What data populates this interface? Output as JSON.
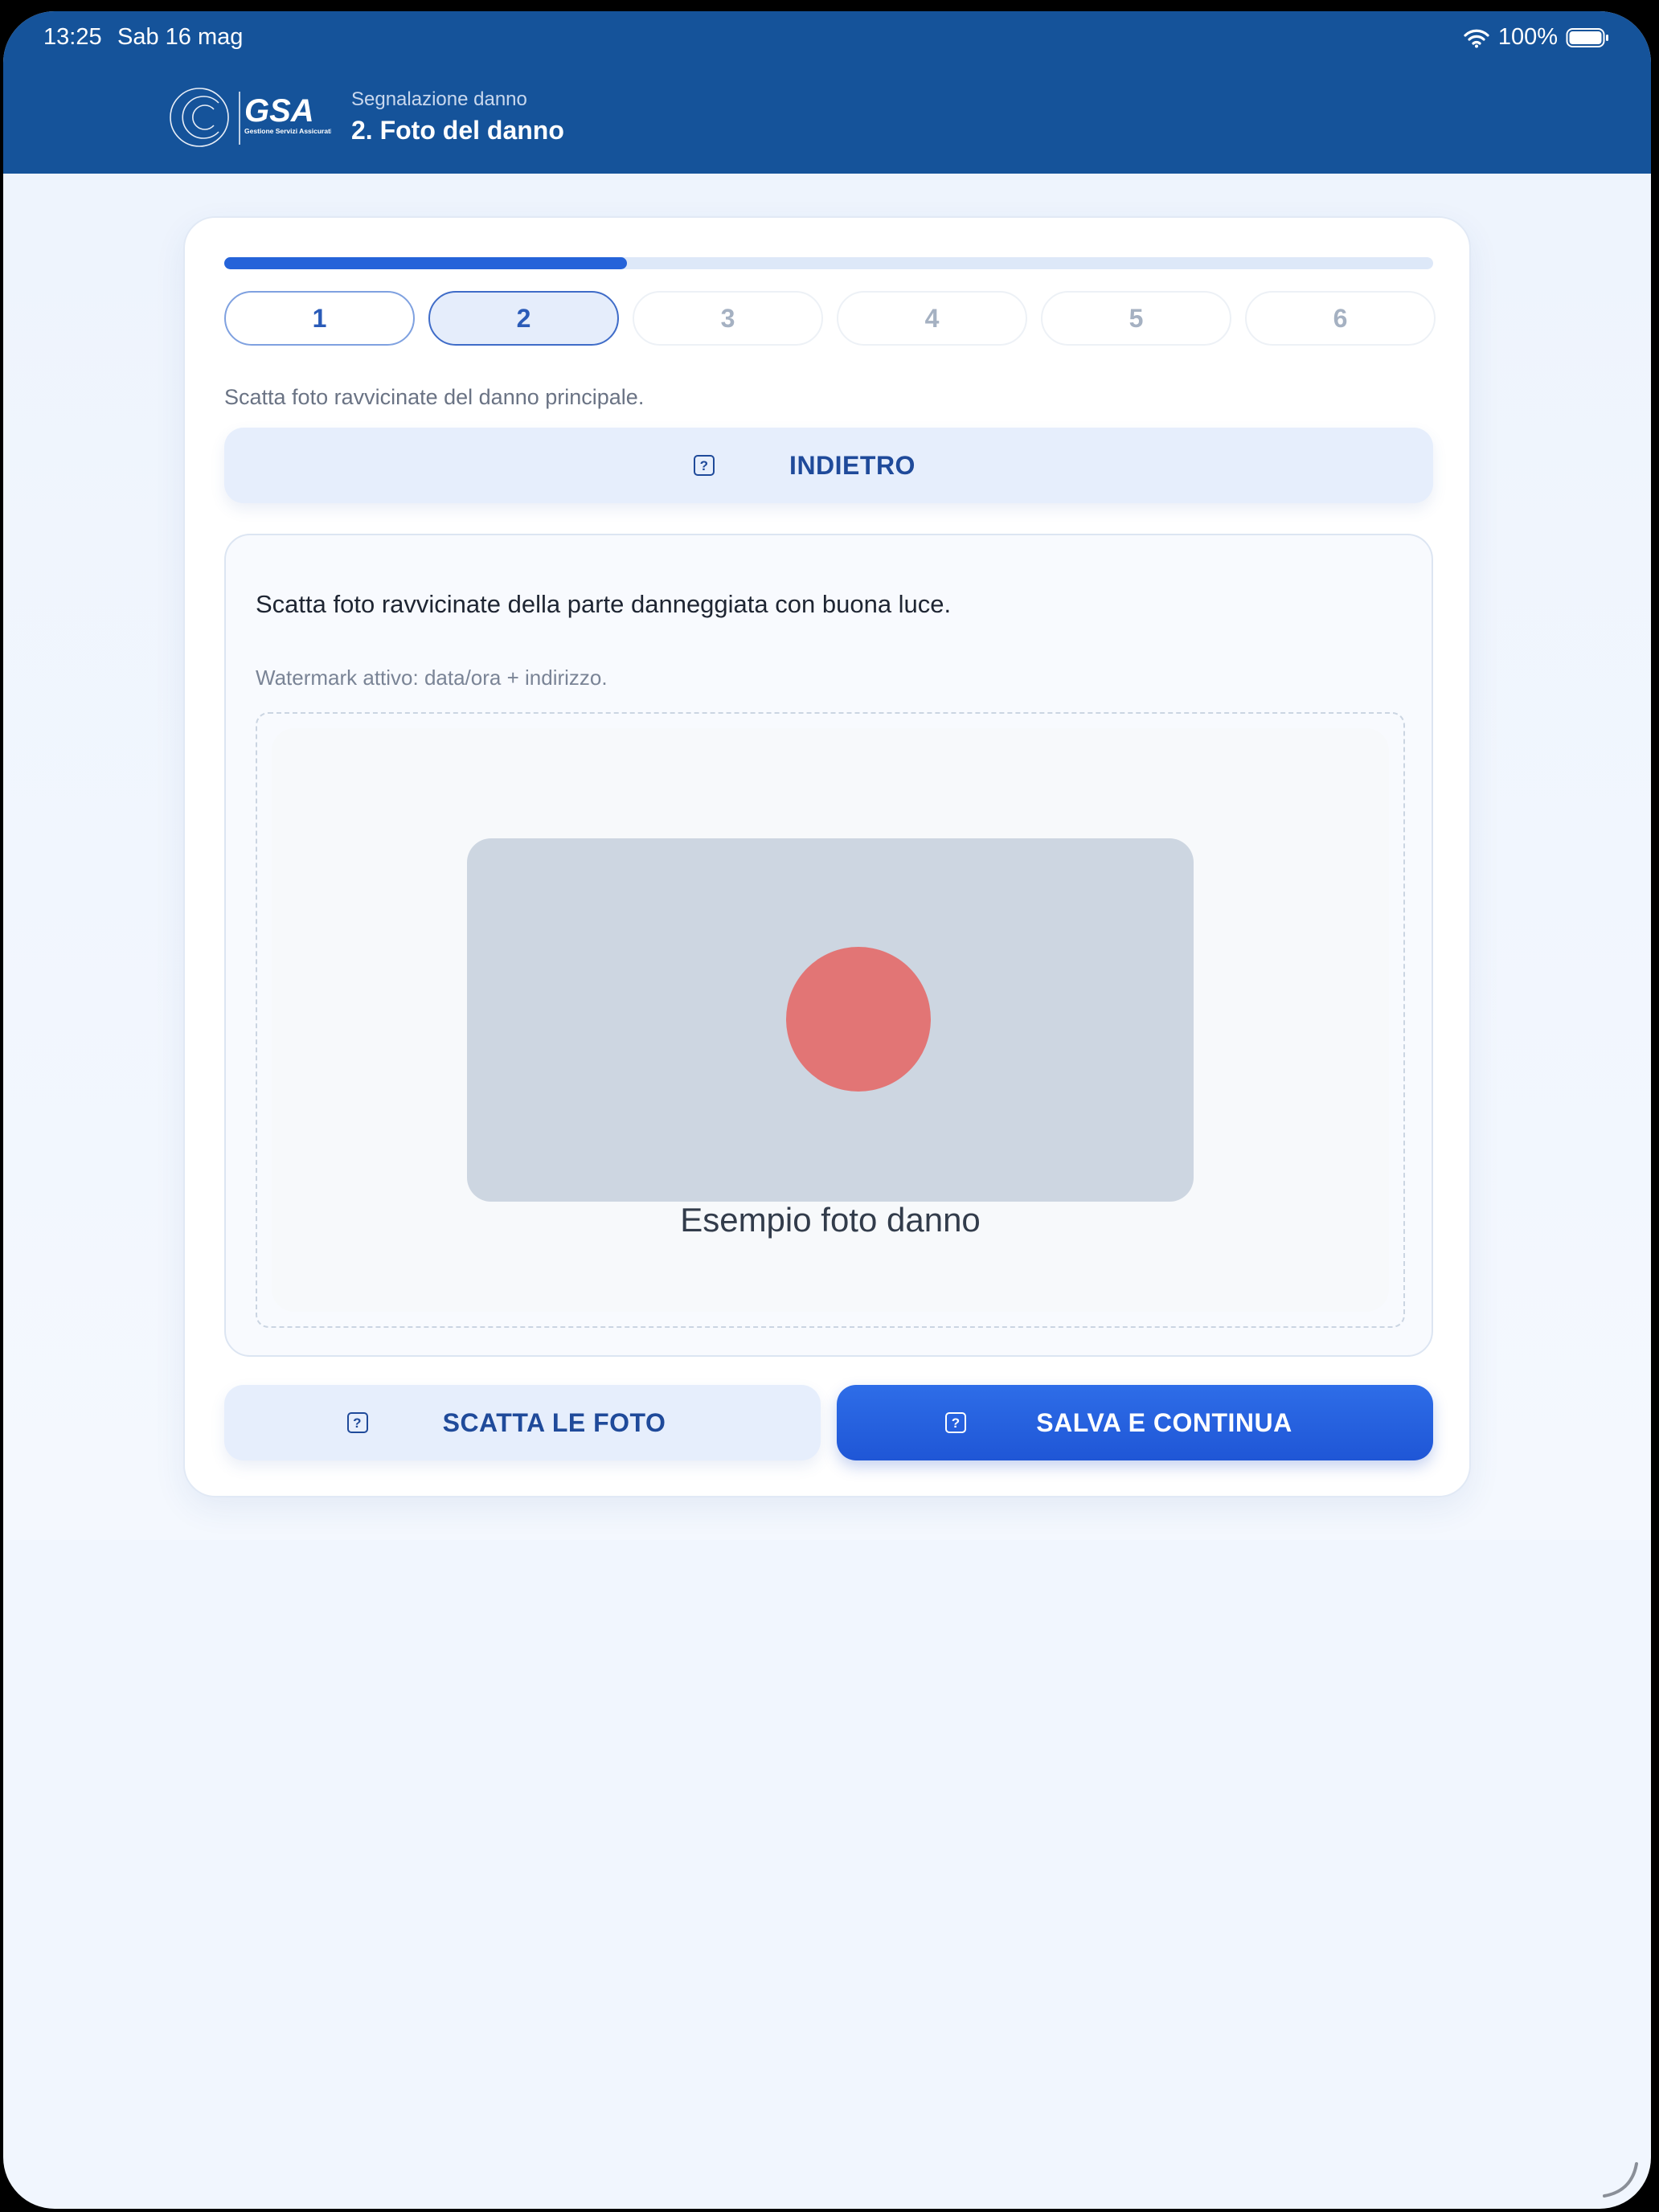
{
  "status_bar": {
    "time": "13:25",
    "date": "Sab 16 mag",
    "battery": "100%"
  },
  "header": {
    "logo_text": "GSA",
    "logo_tagline": "Gestione Servizi Assicurativi",
    "subtitle": "Segnalazione danno",
    "title": "2. Foto del danno"
  },
  "progress": {
    "value": 0.333,
    "steps": [
      {
        "label": "1",
        "state": "done"
      },
      {
        "label": "2",
        "state": "active"
      },
      {
        "label": "3",
        "state": "todo"
      },
      {
        "label": "4",
        "state": "todo"
      },
      {
        "label": "5",
        "state": "todo"
      },
      {
        "label": "6",
        "state": "todo"
      }
    ]
  },
  "hint": "Scatta foto ravvicinate del danno principale.",
  "back_button": {
    "label": "INDIETRO",
    "icon": "help-square-icon"
  },
  "panel": {
    "instruction": "Scatta foto ravvicinate della parte danneggiata con buona luce.",
    "watermark_note": "Watermark attivo: data/ora + indirizzo.",
    "sample_caption": "Esempio foto danno"
  },
  "actions": {
    "take_photos": {
      "label": "SCATTA LE FOTO",
      "icon": "help-square-icon"
    },
    "save_continue": {
      "label": "SALVA E CONTINUA",
      "icon": "help-square-icon"
    }
  },
  "colors": {
    "header_bg": "#15539a",
    "accent": "#2563d9",
    "damage_mark": "#e27575"
  }
}
